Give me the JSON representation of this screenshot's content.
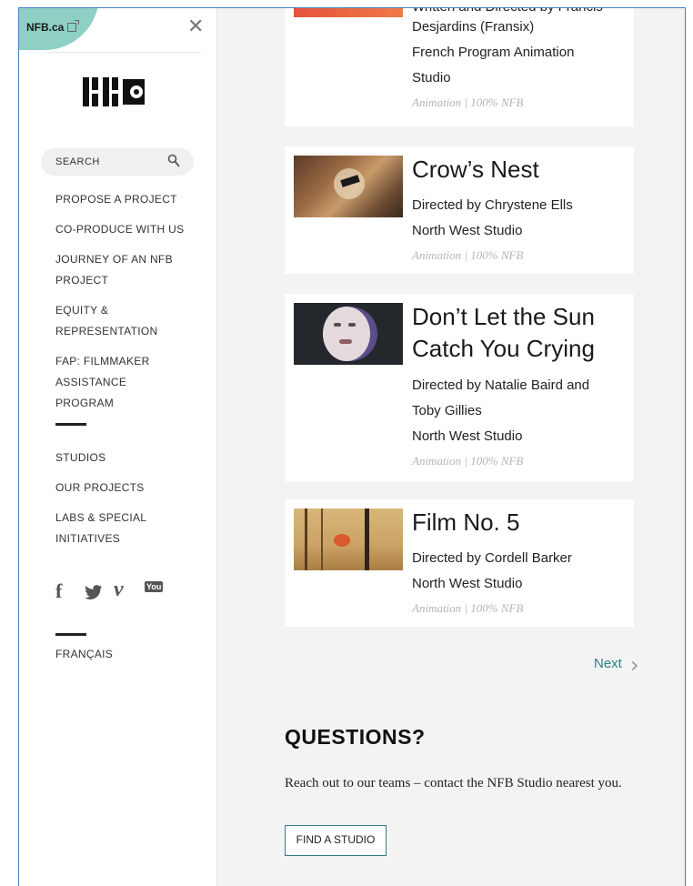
{
  "sidebar": {
    "nfb_link": "NFB.ca",
    "search_label": "SEARCH",
    "nav": {
      "propose": "PROPOSE A PROJECT",
      "coproduce": "CO-PRODUCE WITH US",
      "journey_1": "JOURNEY OF AN NFB",
      "journey_2": "PROJECT",
      "equity_1": "EQUITY &",
      "equity_2": "REPRESENTATION",
      "fap_1": "FAP: FILMMAKER",
      "fap_2": "ASSISTANCE",
      "fap_3": "PROGRAM",
      "studios": "STUDIOS",
      "projects": "OUR PROJECTS",
      "labs_1": "LABS & SPECIAL",
      "labs_2": "INITIATIVES"
    },
    "social": {
      "facebook": "f",
      "vimeo": "v",
      "youtube": "You"
    },
    "language": "FRANÇAIS"
  },
  "cards": [
    {
      "lines": [
        "Written and Directed by Francis",
        "Desjardins (Fransix)",
        "French Program Animation",
        "Studio"
      ],
      "meta": "Animation | 100% NFB"
    },
    {
      "title": "Crow’s Nest",
      "lines": [
        "Directed by Chrystene Ells",
        "North West Studio"
      ],
      "meta": "Animation | 100% NFB"
    },
    {
      "title_1": "Don’t Let the Sun",
      "title_2": "Catch You Crying",
      "lines": [
        "Directed by Natalie Baird and",
        "Toby Gillies",
        "North West Studio"
      ],
      "meta": "Animation | 100% NFB"
    },
    {
      "title": "Film No. 5",
      "lines": [
        "Directed by Cordell Barker",
        "North West Studio"
      ],
      "meta": "Animation | 100% NFB"
    }
  ],
  "pagination": {
    "next": "Next"
  },
  "questions": {
    "title": "QUESTIONS?",
    "text": "Reach out to our teams – contact the NFB Studio nearest you.",
    "button": "FIND A STUDIO"
  }
}
